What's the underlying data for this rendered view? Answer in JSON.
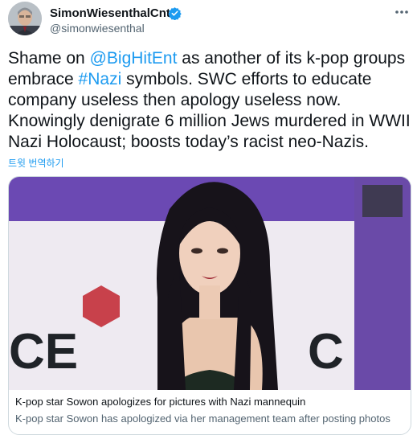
{
  "author": {
    "display_name": "SimonWiesenthalCntr",
    "handle": "@simonwiesenthal",
    "verified": true
  },
  "tweet": {
    "text_1": "Shame on ",
    "mention": "@BigHitEnt",
    "text_2": " as another of its k-pop groups embrace ",
    "hashtag": "#Nazi",
    "text_3": " symbols. SWC efforts to educate company useless then apology useless now. Knowingly denigrate 6 million Jews murdered in WWII Nazi Holocaust; boosts today’s racist neo-Nazis.",
    "translate_label": "트윗 번역하기"
  },
  "card": {
    "backdrop_text_left": "CE",
    "backdrop_text_right": "C",
    "title": "K-pop star Sowon apologizes for pictures with Nazi mannequin",
    "description": "K-pop star Sowon has apologized via her management team after posting photos"
  },
  "colors": {
    "link": "#1d9bf0",
    "verified": "#1d9bf0",
    "backdrop_purple": "#6b49b3",
    "hexagon_red": "#c8414b"
  }
}
